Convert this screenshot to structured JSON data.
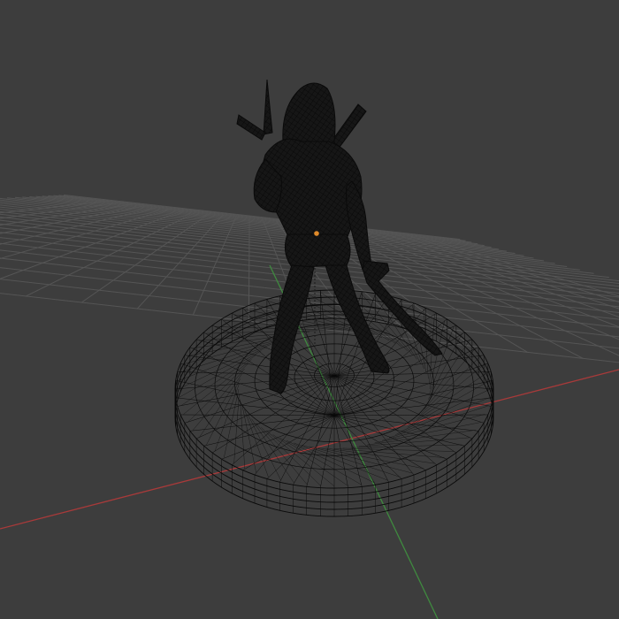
{
  "viewport": {
    "mode": "wireframe",
    "background_color": "#3d3d3d",
    "grid_color": "#555555",
    "x_axis_color": "#a83a3a",
    "y_axis_color": "#3f8a3f",
    "wire_color": "#0a0a0a",
    "origin_color": "#e08a2a",
    "grid_visible": true
  },
  "scene": {
    "object_icon": "figure-with-swords-on-round-base-icon",
    "origin_icon": "object-origin-point-icon"
  }
}
